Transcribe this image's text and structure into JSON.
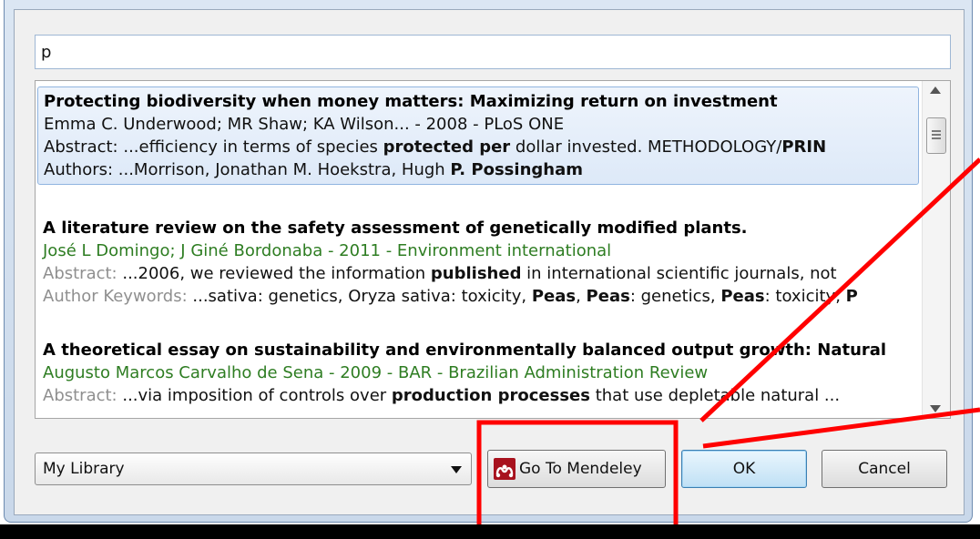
{
  "dialog": {
    "search_value": "p",
    "results": [
      {
        "title": "Protecting biodiversity when money matters: Maximizing return on investment",
        "meta": "Emma C. Underwood; MR Shaw; KA Wilson... - 2008 - PLoS ONE",
        "abstract_label": "Abstract:",
        "abstract_pre": " ...efficiency in terms of species ",
        "abstract_b1": "protected per",
        "abstract_mid": " dollar invested. METHODOLOGY/",
        "abstract_b2": "PRIN",
        "authors_label": "Authors:",
        "authors_pre": " ...Morrison, Jonathan M. Hoekstra, Hugh ",
        "authors_b": "P. Possingham"
      },
      {
        "title": "A literature review on the safety assessment of genetically modified plants.",
        "meta": "José L Domingo; J Giné Bordonaba - 2011 - Environment international",
        "abstract_label": "Abstract:",
        "abstract_pre": " ...2006, we reviewed the information ",
        "abstract_b1": "published",
        "abstract_post": " in international scientific journals, not",
        "keywords_label": "Author Keywords:",
        "kw_pre": " ...sativa: genetics, Oryza sativa: toxicity, ",
        "kw_b1": "Peas",
        "kw_sep1": ", ",
        "kw_b2": "Peas",
        "kw_mid": ": genetics, ",
        "kw_b3": "Peas",
        "kw_post": ": toxicity, ",
        "kw_b4": "P"
      },
      {
        "title": "A theoretical essay on sustainability and environmentally balanced output growth: Natural",
        "meta": "Augusto Marcos Carvalho de Sena - 2009 - BAR - Brazilian Administration Review",
        "abstract_label": "Abstract:",
        "abstract_pre": " ...via imposition of controls over ",
        "abstract_b1": "production processes",
        "abstract_post": " that use depletable natural ..."
      }
    ],
    "library_select": "My Library",
    "buttons": {
      "mendeley": "Go To Mendeley",
      "ok": "OK",
      "cancel": "Cancel"
    }
  },
  "colors": {
    "annotation": "#ff0000",
    "meta_green": "#2e7d22",
    "label_gray": "#8f8f8f",
    "mendeley_red": "#a8121e"
  }
}
